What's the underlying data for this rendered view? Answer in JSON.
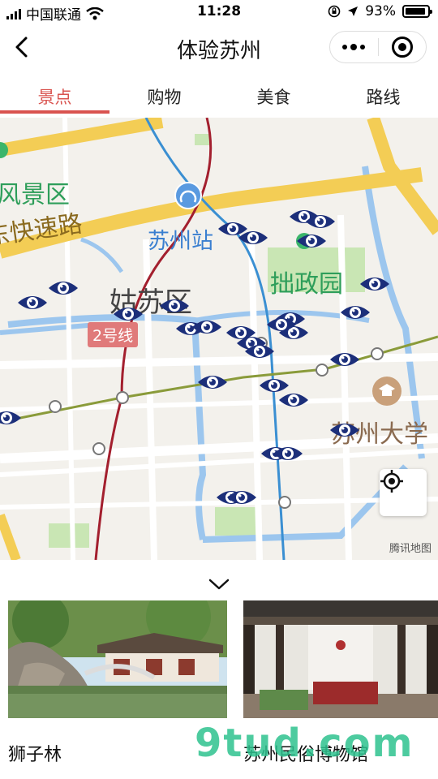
{
  "status": {
    "carrier": "中国联通",
    "time": "11:28",
    "battery": "93%",
    "battery_level": 0.93
  },
  "nav": {
    "title": "体验苏州"
  },
  "tabs": [
    {
      "label": "景点",
      "active": true
    },
    {
      "label": "购物",
      "active": false
    },
    {
      "label": "美食",
      "active": false
    },
    {
      "label": "路线",
      "active": false
    }
  ],
  "map": {
    "labels": {
      "scenic_area": "风景区",
      "expressway": "东快速路",
      "station": "苏州站",
      "zhuozheng": "拙政园",
      "gusu": "姑苏区",
      "line2": "2号线",
      "university": "苏州大学"
    },
    "provider": "腾讯地图"
  },
  "cards": [
    {
      "name": "狮子林"
    },
    {
      "name": "苏州民俗博物馆"
    }
  ],
  "watermark": "9tud.com",
  "colors": {
    "accent": "#d9534f",
    "marker": "#1c2f7a",
    "road_yellow": "#f3cd55",
    "water": "#9cc6ee",
    "park": "#c9e6b4"
  }
}
